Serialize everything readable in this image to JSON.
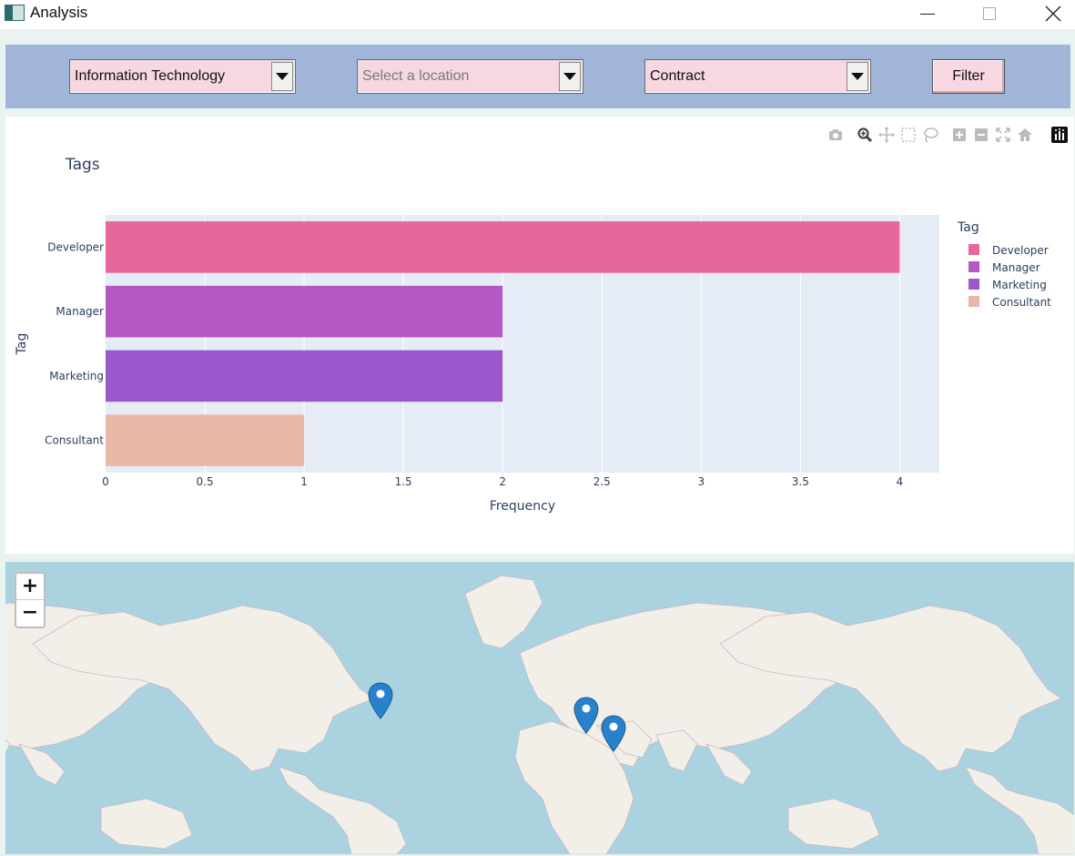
{
  "window": {
    "title": "Analysis"
  },
  "filters": {
    "industry": {
      "value": "Information Technology"
    },
    "location": {
      "placeholder": "Select a location",
      "value": ""
    },
    "contract": {
      "value": "Contract"
    },
    "filter_button_label": "Filter"
  },
  "chart_data": {
    "type": "bar",
    "orientation": "horizontal",
    "title": "Tags",
    "xlabel": "Frequency",
    "ylabel": "Tag",
    "categories": [
      "Developer",
      "Manager",
      "Marketing",
      "Consultant"
    ],
    "values": [
      4,
      2,
      2,
      1
    ],
    "colors": [
      "#e8679a",
      "#b558c4",
      "#9b58cc",
      "#e9b7a8"
    ],
    "xlim": [
      0,
      4.2
    ],
    "xticks": [
      "0",
      "0.5",
      "1",
      "1.5",
      "2",
      "2.5",
      "3",
      "3.5",
      "4"
    ],
    "grid": true,
    "legend": {
      "title": "Tag",
      "placement": "right",
      "entries": [
        "Developer",
        "Manager",
        "Marketing",
        "Consultant"
      ]
    }
  },
  "modebar": {
    "icons": [
      "camera-icon",
      "zoom-icon",
      "pan-icon",
      "box-select-icon",
      "lasso-icon",
      "zoom-in-icon",
      "zoom-out-icon",
      "autoscale-icon",
      "reset-axes-icon",
      "plotly-logo-icon"
    ]
  },
  "map": {
    "zoom_in_label": "+",
    "zoom_out_label": "−",
    "colors": {
      "water": "#aad3df",
      "land": "#f2efe9"
    },
    "markers": [
      "us-west-marker",
      "middle-east-marker",
      "south-asia-marker"
    ]
  }
}
